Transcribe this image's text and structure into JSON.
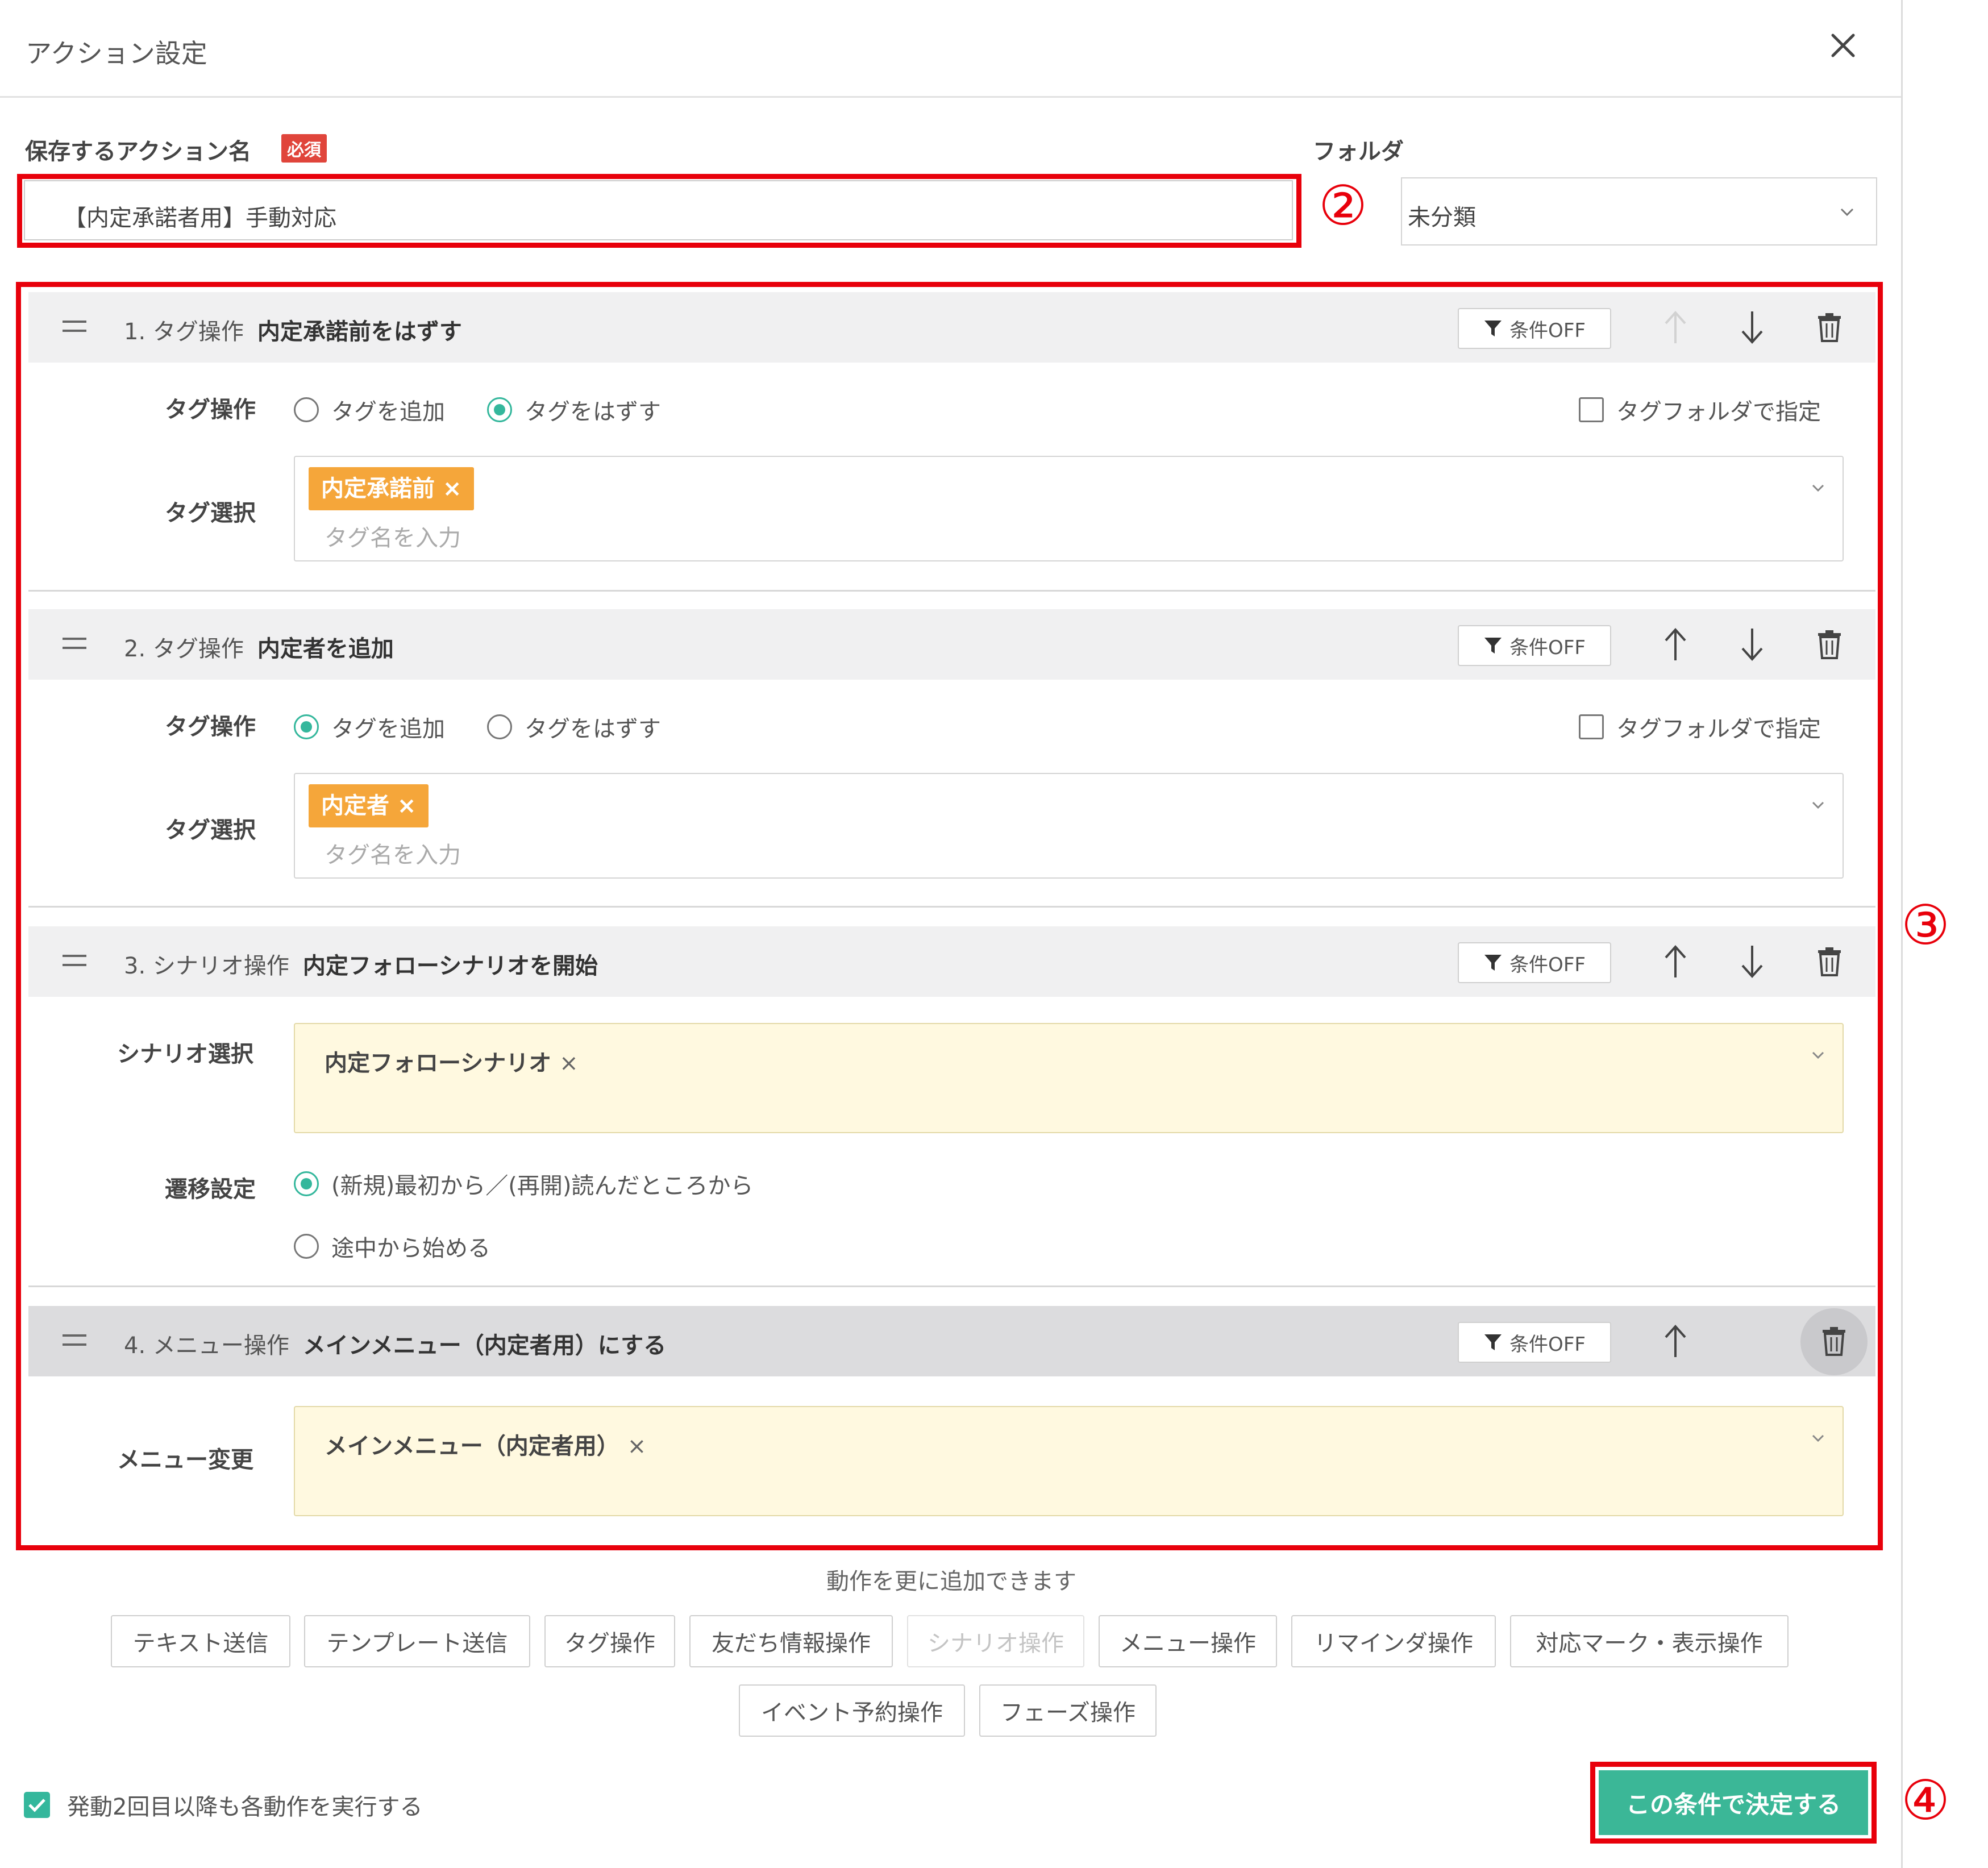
{
  "dialog": {
    "title": "アクション設定"
  },
  "form": {
    "name_label": "保存するアクション名",
    "required_badge": "必須",
    "name_value": "【内定承諾者用】手動対応",
    "folder_label": "フォルダ",
    "folder_value": "未分類"
  },
  "annotations": {
    "two": "②",
    "three": "③",
    "four": "④"
  },
  "condition_button_label": "条件OFF",
  "sections": [
    {
      "number_type": "1. タグ操作",
      "title": "内定承諾前をはずす",
      "op_label": "タグ操作",
      "opt_add": "タグを追加",
      "opt_remove": "タグをはずす",
      "selected": "remove",
      "folder_check": "タグフォルダで指定",
      "select_label": "タグ選択",
      "chip": "内定承諾前 ×",
      "placeholder": "タグ名を入力"
    },
    {
      "number_type": "2. タグ操作",
      "title": "内定者を追加",
      "op_label": "タグ操作",
      "opt_add": "タグを追加",
      "opt_remove": "タグをはずす",
      "selected": "add",
      "folder_check": "タグフォルダで指定",
      "select_label": "タグ選択",
      "chip": "内定者 ×",
      "placeholder": "タグ名を入力"
    },
    {
      "number_type": "3. シナリオ操作",
      "title": "内定フォローシナリオを開始",
      "select_label": "シナリオ選択",
      "value": "内定フォローシナリオ",
      "remove_x": "×",
      "transition_label": "遷移設定",
      "trans_opt1": "(新規)最初から／(再開)読んだところから",
      "trans_opt2": "途中から始める"
    },
    {
      "number_type": "4. メニュー操作",
      "title": "メインメニュー（内定者用）にする",
      "select_label": "メニュー変更",
      "value": "メインメニュー（内定者用）",
      "remove_x": "×"
    }
  ],
  "add_more_text": "動作を更に追加できます",
  "action_buttons": [
    "テキスト送信",
    "テンプレート送信",
    "タグ操作",
    "友だち情報操作",
    "シナリオ操作",
    "メニュー操作",
    "リマインダ操作",
    "対応マーク・表示操作",
    "イベント予約操作",
    "フェーズ操作"
  ],
  "footer": {
    "repeat_check": "発動2回目以降も各動作を実行する",
    "submit": "この条件で決定する"
  },
  "colors": {
    "accent": "#34b79c",
    "annotation_red": "#e8000b",
    "chip": "#f5a63a",
    "badge": "#e0453b"
  }
}
